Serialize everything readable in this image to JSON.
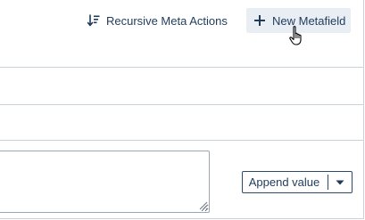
{
  "toolbar": {
    "recursive_label": "Recursive Meta Actions",
    "recursive_icon": "sort-descending-icon",
    "new_label": "New Metafield",
    "new_icon": "plus-icon"
  },
  "editor": {
    "value": "",
    "resize_icon": "resize-grip-icon"
  },
  "append": {
    "label": "Append value",
    "caret_icon": "caret-down-icon"
  },
  "colors": {
    "text": "#1f3b5b",
    "border": "#c9d1da",
    "button_bg": "#e9eef4",
    "dark_border": "#2d4a6b"
  }
}
